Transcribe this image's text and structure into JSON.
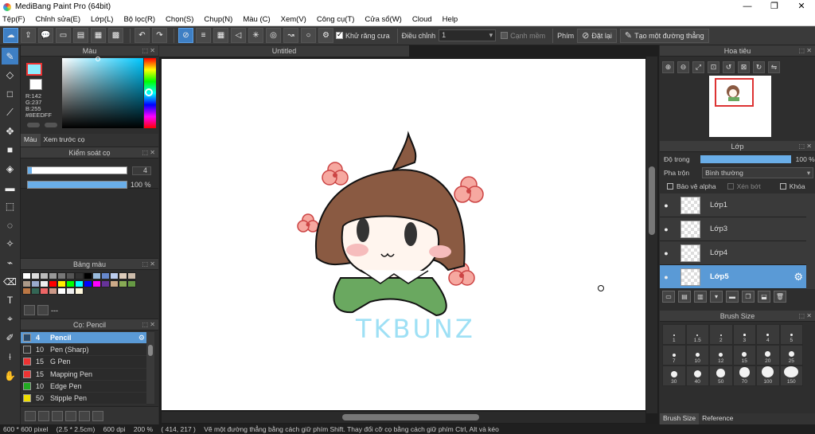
{
  "window": {
    "title": "MediBang Paint Pro (64bit)",
    "minimize": "—",
    "restore": "❐",
    "close": "✕"
  },
  "menu": [
    "Tệp(F)",
    "Chỉnh sửa(E)",
    "Lớp(L)",
    "Bộ lọc(R)",
    "Chọn(S)",
    "Chụp(N)",
    "Màu (C)",
    "Xem(V)",
    "Công cụ(T)",
    "Cửa sổ(W)",
    "Cloud",
    "Help"
  ],
  "toolbar": {
    "antialias_label": "Khử răng cưa",
    "adjust_label": "Điều chỉnh",
    "adjust_value": "1",
    "edge_label": "Cạnh mềm",
    "key_label": "Phím",
    "reset_label": "Đặt lại",
    "straight_line_label": "Tạo một đường thẳng"
  },
  "color_panel": {
    "title": "Màu",
    "rgb_r": "R:142",
    "rgb_g": "G:237",
    "rgb_b": "B:255",
    "hex": "#8EEDFF",
    "tab_color": "Màu",
    "tab_brush_preview": "Xem trước cọ",
    "fg_color": "#8EEDFF"
  },
  "brush_control": {
    "title": "Kiểm soát cọ",
    "size_value": "4",
    "opacity_value": "100 %"
  },
  "palette": {
    "title": "Bảng màu",
    "label": "---",
    "colors": [
      "#ffffff",
      "#dddddd",
      "#bbbbbb",
      "#999999",
      "#777777",
      "#555555",
      "#333333",
      "#000000",
      "#99bbdd",
      "#6688cc",
      "#bbccee",
      "#ddccbb",
      "#ccbbaa",
      "#aa9988",
      "#99aacc",
      "#eeeeee",
      "#ff0000",
      "#ffee00",
      "#00ff00",
      "#00ffff",
      "#0000ff",
      "#ff00ff",
      "#663399",
      "#ccaa88",
      "#88aa55",
      "#669944",
      "#bb7744",
      "#336655",
      "#ee6666",
      "#cc9988",
      "#ffffff",
      "#eeeeee",
      "#fff8dd"
    ]
  },
  "brushes": {
    "title": "Cọ: Pencil",
    "items": [
      {
        "size": "4",
        "name": "Pencil",
        "color": "#2a4a6a"
      },
      {
        "size": "10",
        "name": "Pen (Sharp)",
        "color": "#333333"
      },
      {
        "size": "15",
        "name": "G Pen",
        "color": "#ee3333"
      },
      {
        "size": "15",
        "name": "Mapping Pen",
        "color": "#ee3333"
      },
      {
        "size": "10",
        "name": "Edge Pen",
        "color": "#22aa22"
      },
      {
        "size": "50",
        "name": "Stipple Pen",
        "color": "#eedd00"
      }
    ]
  },
  "canvas": {
    "tab_title": "Untitled",
    "art_text": "TKBUNZ"
  },
  "navigator": {
    "title": "Hoa tiêu"
  },
  "layers": {
    "title": "Lớp",
    "opacity_label": "Độ trong",
    "opacity_value": "100 %",
    "blend_label": "Pha trộn",
    "blend_value": "Bình thường",
    "protect_alpha": "Bảo vệ alpha",
    "clipping": "Xén bớt",
    "lock": "Khóa",
    "items": [
      {
        "name": "Lớp1",
        "selected": false
      },
      {
        "name": "Lớp3",
        "selected": false
      },
      {
        "name": "Lớp4",
        "selected": false
      },
      {
        "name": "Lớp5",
        "selected": true
      }
    ]
  },
  "brush_size": {
    "title": "Brush Size",
    "values": [
      "1",
      "1.5",
      "2",
      "3",
      "4",
      "5",
      "7",
      "10",
      "12",
      "15",
      "20",
      "25",
      "30",
      "40",
      "50",
      "70",
      "100",
      "150"
    ],
    "tab_brush_size": "Brush Size",
    "tab_reference": "Reference"
  },
  "status": {
    "size": "600 * 600 pixel",
    "cm": "(2.5 * 2.5cm)",
    "dpi": "600 dpi",
    "zoom": "200 %",
    "coords": "( 414, 217 )",
    "hint": "Vẽ một đường thẳng bằng cách giữ phím Shift. Thay đổi cỡ cọ bằng cách giữ phím Ctrl, Alt và kéo"
  }
}
